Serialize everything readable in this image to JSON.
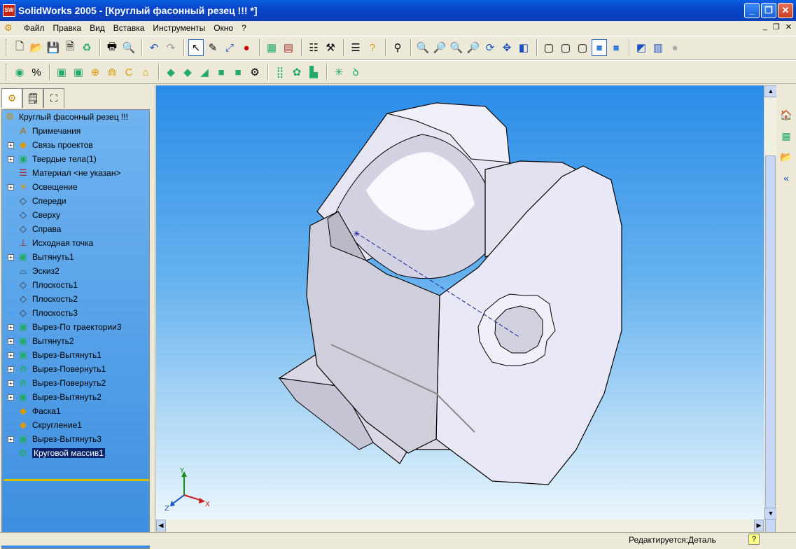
{
  "window": {
    "title": "SolidWorks 2005 - [Круглый фасонный резец !!! *]",
    "app_icon": "SW"
  },
  "menu": {
    "items": [
      "Файл",
      "Правка",
      "Вид",
      "Вставка",
      "Инструменты",
      "Окно",
      "?"
    ]
  },
  "toolbar1": {
    "buttons": [
      "new-icon",
      "open-icon",
      "save-icon",
      "print-preview-icon",
      "rebuild-icon",
      "print-icon",
      "preview-icon",
      "undo-icon",
      "redo-icon",
      "select-icon",
      "sketch-icon",
      "smart-dim-icon",
      "traffic-light-icon",
      "color-grid-icon",
      "brick-icon",
      "options-icon",
      "options2-icon",
      "list-icon",
      "help-icon",
      "select-filter-icon",
      "zoom-fit-icon",
      "zoom-area-icon",
      "zoom-in-icon",
      "zoom-out-icon",
      "rotate-icon",
      "pan-icon",
      "standard-views-icon",
      "wireframe-icon",
      "hidden-lines-icon",
      "hidden-removed-icon",
      "shaded-edges-icon",
      "shaded-icon",
      "perspective-icon",
      "section-view-icon",
      "realview-icon"
    ]
  },
  "toolbar2": {
    "buttons": [
      "feature-extrude-icon",
      "boss-revolve-icon",
      "extrude-cut-icon",
      "sweep-icon",
      "revolve-cut-icon",
      "loft-icon",
      "fillet-icon",
      "chamfer-icon",
      "shell-icon",
      "rib-icon",
      "draft-icon",
      "hole-wizard-icon",
      "linear-pattern-icon",
      "circular-pattern-icon",
      "mirror-icon",
      "reference-geometry-icon",
      "curves-icon"
    ]
  },
  "panel": {
    "tabs": [
      "feature-manager-tab",
      "property-manager-tab",
      "configuration-manager-tab"
    ]
  },
  "tree": {
    "root": "Круглый фасонный резец !!!",
    "items": [
      {
        "label": "Примечания",
        "icon": "annotations-icon",
        "expandable": false
      },
      {
        "label": "Связь проектов",
        "icon": "design-binder-icon",
        "expandable": true
      },
      {
        "label": "Твердые тела(1)",
        "icon": "solid-bodies-icon",
        "expandable": true
      },
      {
        "label": "Материал <не указан>",
        "icon": "material-icon",
        "expandable": false
      },
      {
        "label": "Освещение",
        "icon": "lighting-icon",
        "expandable": true
      },
      {
        "label": "Спереди",
        "icon": "plane-icon",
        "expandable": false
      },
      {
        "label": "Сверху",
        "icon": "plane-icon",
        "expandable": false
      },
      {
        "label": "Справа",
        "icon": "plane-icon",
        "expandable": false
      },
      {
        "label": "Исходная точка",
        "icon": "origin-icon",
        "expandable": false
      },
      {
        "label": "Вытянуть1",
        "icon": "extrude-icon",
        "expandable": true
      },
      {
        "label": "Эскиз2",
        "icon": "sketch-icon",
        "expandable": false
      },
      {
        "label": "Плоскость1",
        "icon": "plane-icon",
        "expandable": false
      },
      {
        "label": "Плоскость2",
        "icon": "plane-icon",
        "expandable": false
      },
      {
        "label": "Плоскость3",
        "icon": "plane-icon",
        "expandable": false
      },
      {
        "label": "Вырез-По траектории3",
        "icon": "sweep-cut-icon",
        "expandable": true
      },
      {
        "label": "Вытянуть2",
        "icon": "extrude-icon",
        "expandable": true
      },
      {
        "label": "Вырез-Вытянуть1",
        "icon": "extrude-cut-icon",
        "expandable": true
      },
      {
        "label": "Вырез-Повернуть1",
        "icon": "revolve-cut-icon",
        "expandable": true
      },
      {
        "label": "Вырез-Повернуть2",
        "icon": "revolve-cut-icon",
        "expandable": true
      },
      {
        "label": "Вырез-Вытянуть2",
        "icon": "extrude-cut-icon",
        "expandable": true
      },
      {
        "label": "Фаска1",
        "icon": "chamfer-icon",
        "expandable": false
      },
      {
        "label": "Скругление1",
        "icon": "fillet-icon",
        "expandable": false
      },
      {
        "label": "Вырез-Вытянуть3",
        "icon": "extrude-cut-icon",
        "expandable": true
      },
      {
        "label": "Круговой массив1",
        "icon": "circular-pattern-icon",
        "expandable": false,
        "selected": true
      }
    ]
  },
  "triad": {
    "x": "X",
    "y": "Y",
    "z": "Z"
  },
  "right_panel": {
    "buttons": [
      "home-icon",
      "appearance-icon",
      "folder-icon",
      "collapse-icon"
    ]
  },
  "status": {
    "text": "Редактируется:Деталь",
    "help": "?"
  }
}
